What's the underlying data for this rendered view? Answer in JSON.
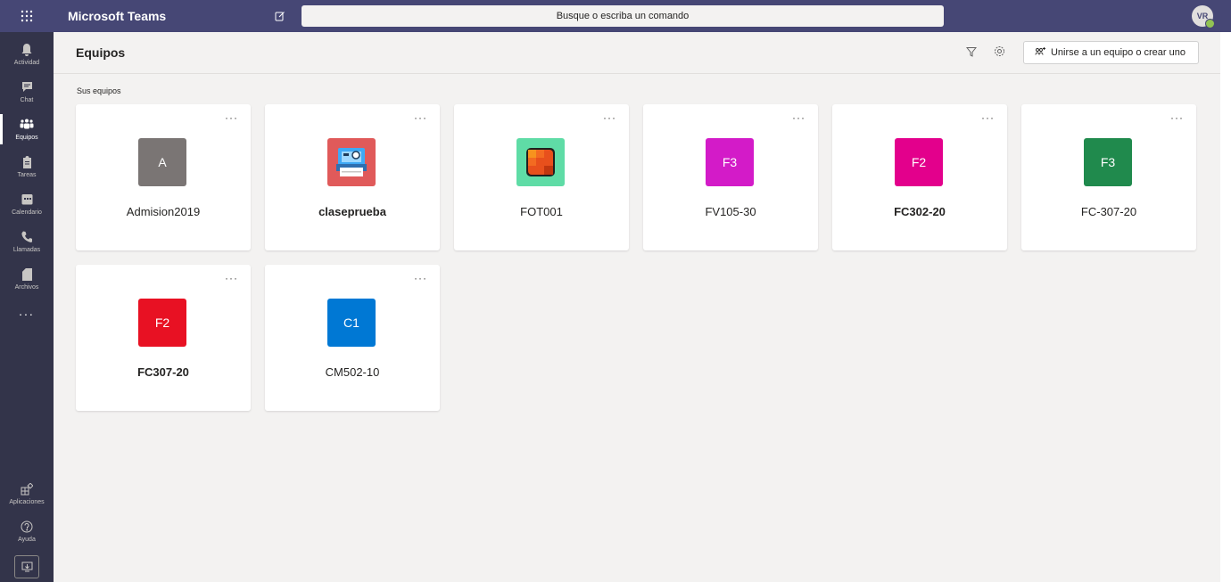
{
  "topbar": {
    "app_title": "Microsoft Teams",
    "search_placeholder": "Busque o escriba un comando",
    "avatar_initials": "VR",
    "presence_color": "#92c353",
    "bar_color": "#464775"
  },
  "rail": {
    "items": [
      {
        "label": "Actividad",
        "icon": "bell-icon"
      },
      {
        "label": "Chat",
        "icon": "chat-icon"
      },
      {
        "label": "Equipos",
        "icon": "teams-icon",
        "active": true
      },
      {
        "label": "Tareas",
        "icon": "assignments-icon"
      },
      {
        "label": "Calendario",
        "icon": "calendar-icon"
      },
      {
        "label": "Llamadas",
        "icon": "phone-icon"
      },
      {
        "label": "Archivos",
        "icon": "files-icon"
      }
    ],
    "more": "...",
    "bottom": [
      {
        "label": "Aplicaciones",
        "icon": "apps-icon"
      },
      {
        "label": "Ayuda",
        "icon": "help-icon"
      }
    ]
  },
  "header": {
    "title": "Equipos",
    "join_button": "Unirse a un equipo o crear uno"
  },
  "content": {
    "section_label": "Sus equipos",
    "teams": [
      {
        "name": "Admision2019",
        "initials": "A",
        "color": "#7a7574",
        "bold": false,
        "image": false
      },
      {
        "name": "claseprueba",
        "initials": "",
        "color": "#e05a5a",
        "bold": true,
        "image": true,
        "icon": "printer-icon"
      },
      {
        "name": "FOT001",
        "initials": "",
        "color": "#5fdca6",
        "bold": false,
        "image": true,
        "icon": "orange-tile-icon"
      },
      {
        "name": "FV105-30",
        "initials": "F3",
        "color": "#d31bc8",
        "bold": false,
        "image": false
      },
      {
        "name": "FC302-20",
        "initials": "F2",
        "color": "#e3008c",
        "bold": true,
        "image": false
      },
      {
        "name": "FC-307-20",
        "initials": "F3",
        "color": "#208a4d",
        "bold": false,
        "image": false
      },
      {
        "name": "FC307-20",
        "initials": "F2",
        "color": "#e81123",
        "bold": true,
        "image": false
      },
      {
        "name": "CM502-10",
        "initials": "C1",
        "color": "#0078d4",
        "bold": false,
        "image": false
      }
    ]
  }
}
